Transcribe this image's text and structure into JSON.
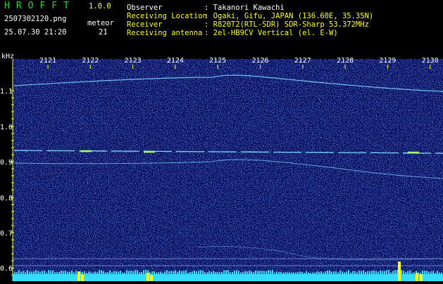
{
  "header": {
    "app_name": "HROFFT",
    "version": "1.0.0",
    "filename": "2507302120.png",
    "meteor_label": "meteor",
    "timestamp": "25.07.30 21:20",
    "meteor_count": "21",
    "info": [
      {
        "label": "Observer",
        "value": ": Takanori Kawachi"
      },
      {
        "label": "Receiving Location",
        "value": ": Ogaki, Gifu, JAPAN (136.60E, 35.35N)"
      },
      {
        "label": "Receiver",
        "value": ": R820T2(RTL-SDR) SDR-Sharp 53.372MHz"
      },
      {
        "label": "Receiving antenna",
        "value": ": 2el-HB9CV Vertical (el. E-W)"
      }
    ]
  },
  "spectrogram": {
    "unit_label": "kHz",
    "time_ticks": [
      "2121",
      "2122",
      "2123",
      "2124",
      "2125",
      "2126",
      "2127",
      "2128",
      "2129",
      "2130"
    ],
    "freq_ticks": [
      "1.1",
      "1.0",
      "0.9",
      "0.8",
      "0.7",
      "0.6"
    ],
    "colors": {
      "background": "#050a5a",
      "noise": "#1e3fc8",
      "trace": "#7fe0ff",
      "axis": "#ffff00",
      "baseline": "#33ddff",
      "burst": "#ffff00"
    }
  }
}
